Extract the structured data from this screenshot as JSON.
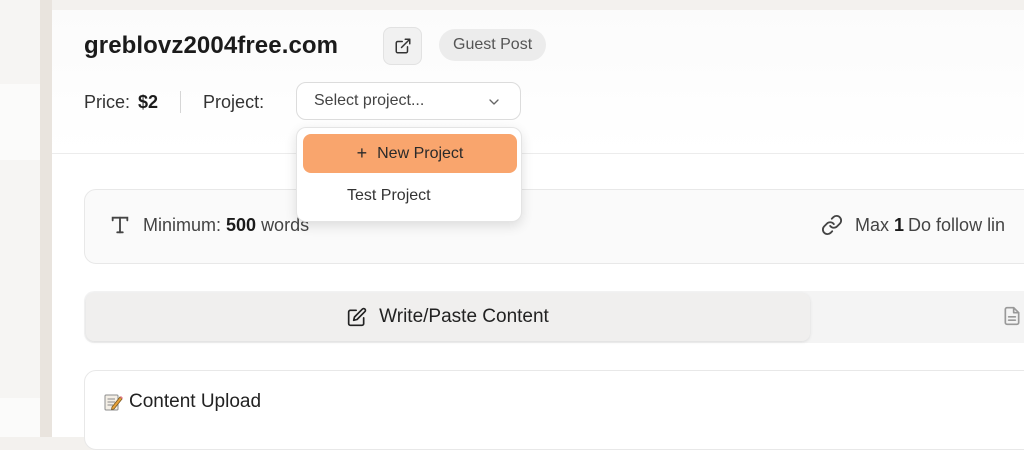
{
  "site": {
    "title": "greblovz2004free.com",
    "badge": "Guest Post"
  },
  "price": {
    "label": "Price:",
    "value": "$2"
  },
  "project": {
    "label": "Project:",
    "placeholder": "Select project...",
    "options": [
      {
        "label": "New Project",
        "icon": "plus-icon",
        "highlighted": true
      },
      {
        "label": "Test Project"
      }
    ]
  },
  "requirements": {
    "min_label": "Minimum:",
    "min_value": "500",
    "min_unit": "words",
    "max_label": "Max",
    "max_value": "1",
    "max_unit": "Do follow lin"
  },
  "tabs": {
    "active": "Write/Paste Content"
  },
  "upload": {
    "title": "Content Upload"
  },
  "colors": {
    "accent": "#f9a56d"
  }
}
